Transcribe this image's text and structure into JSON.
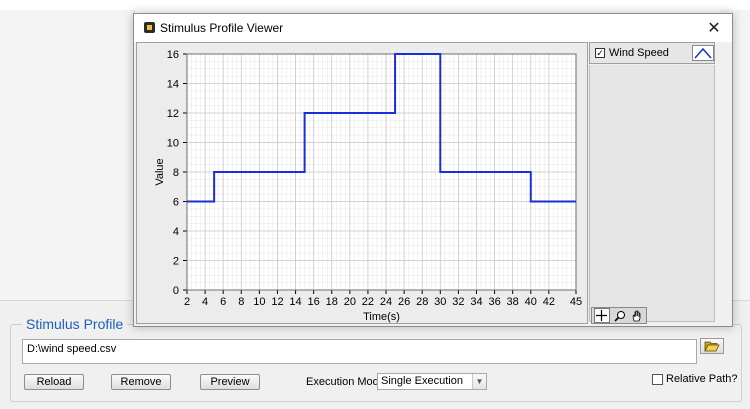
{
  "dialog": {
    "title": "Stimulus Profile Viewer",
    "close_glyph": "✕"
  },
  "legend": {
    "checked": true,
    "check_glyph": "✓",
    "label": "Wind Speed"
  },
  "tools": [
    {
      "name": "cursor-move-icon"
    },
    {
      "name": "zoom-icon"
    },
    {
      "name": "pan-hand-icon"
    }
  ],
  "panel": {
    "title": "Stimulus Profile",
    "path_value": "D:\\wind speed.csv",
    "browse_icon": "folder-open-icon",
    "reload_label": "Reload",
    "remove_label": "Remove",
    "preview_label": "Preview",
    "exec_mode_label": "Execution Mode",
    "exec_mode_value": "Single Execution",
    "relative_path_label": "Relative Path?",
    "relative_path_checked": false
  },
  "colors": {
    "series": "#1a2fd6",
    "grid_major": "#c8c8c8",
    "grid_minor": "#e4e4e4",
    "title_blue": "#1c5fb8"
  },
  "chart_data": {
    "type": "line",
    "step": true,
    "xlabel": "Time(s)",
    "ylabel": "Value",
    "xlim": [
      2,
      45
    ],
    "ylim": [
      0,
      16
    ],
    "xticks": [
      2,
      4,
      6,
      8,
      10,
      12,
      14,
      16,
      18,
      20,
      22,
      24,
      26,
      28,
      30,
      32,
      34,
      36,
      38,
      40,
      42,
      45
    ],
    "yticks": [
      0,
      2,
      4,
      6,
      8,
      10,
      12,
      14,
      16
    ],
    "grid": true,
    "series": [
      {
        "name": "Wind Speed",
        "x": [
          2,
          5,
          5,
          15,
          15,
          25,
          25,
          30,
          30,
          40,
          40,
          45
        ],
        "y": [
          6,
          6,
          8,
          8,
          12,
          12,
          16,
          16,
          8,
          8,
          6,
          6
        ]
      }
    ]
  }
}
